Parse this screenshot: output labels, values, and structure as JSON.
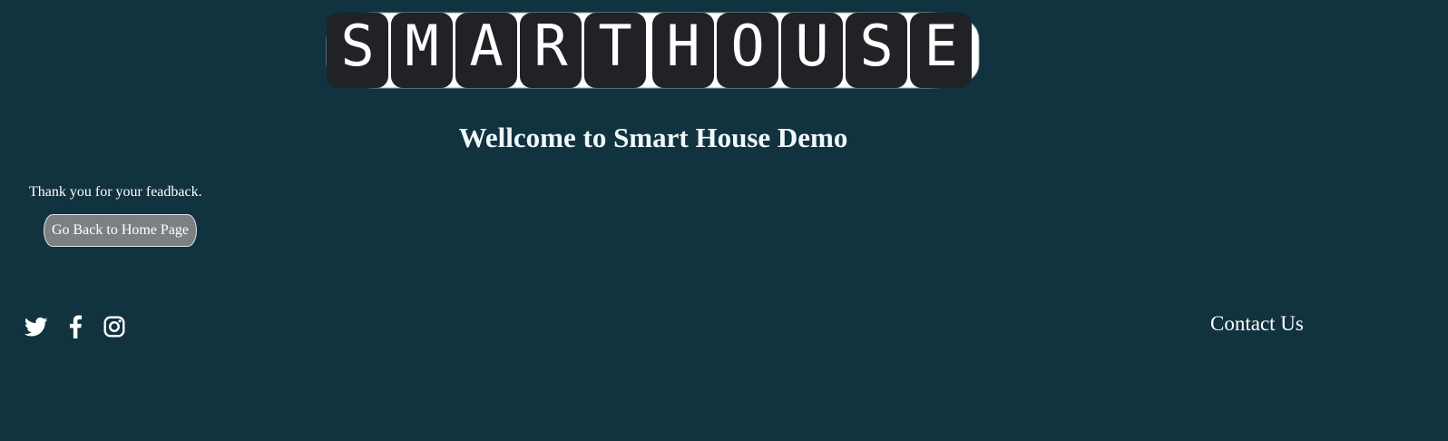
{
  "logo": {
    "text": "SMART HOUSE",
    "letters": [
      "S",
      "M",
      "A",
      "R",
      "T",
      "H",
      "O",
      "U",
      "S",
      "E"
    ]
  },
  "heading": "Wellcome to Smart House Demo",
  "message": "Thank you for your feadback.",
  "back_button_label": "Go Back to Home Page",
  "social": {
    "icons": [
      "twitter-icon",
      "facebook-icon",
      "instagram-icon"
    ]
  },
  "contact_label": "Contact Us",
  "colors": {
    "page_background": "#11323f",
    "logo_tile": "#202226",
    "button_background": "#7d8083",
    "text": "#ffffff"
  }
}
